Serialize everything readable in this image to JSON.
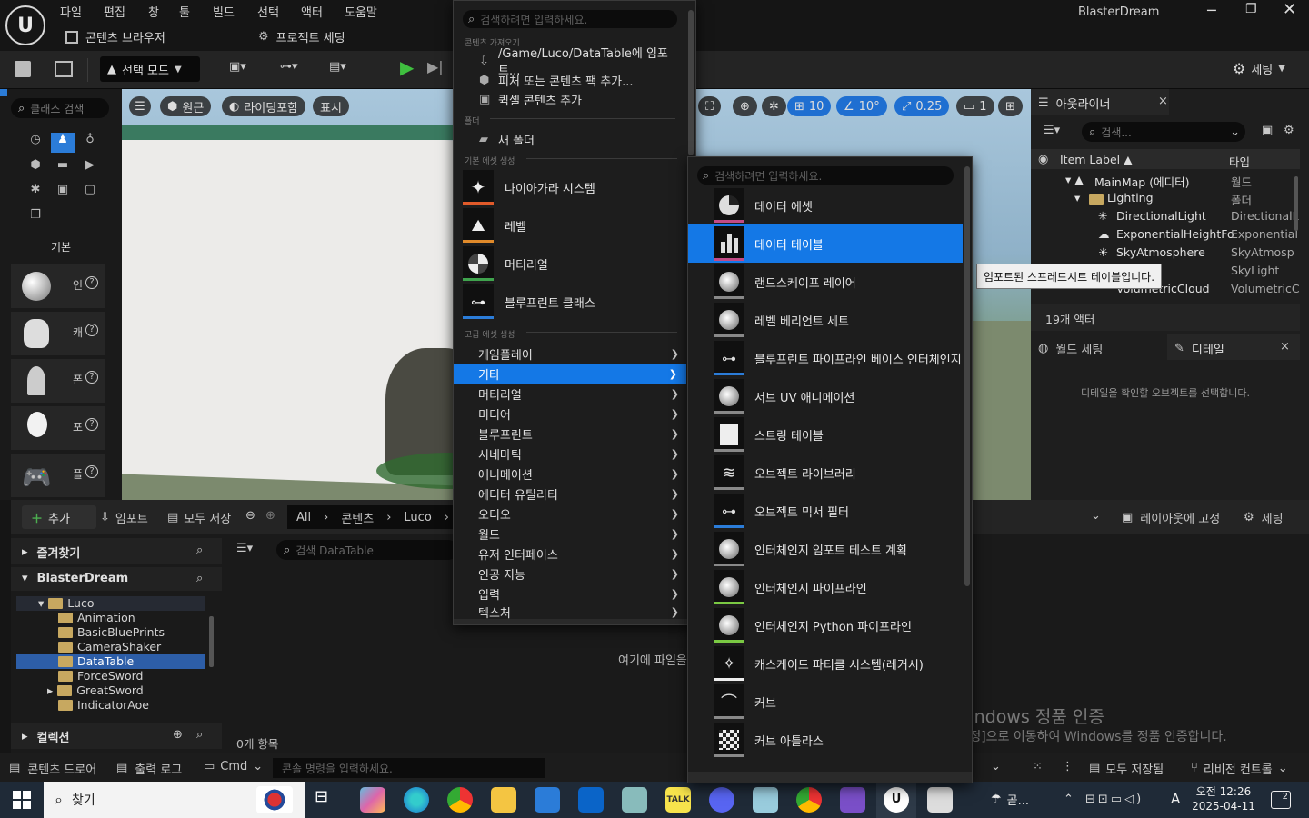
{
  "menubar": {
    "items": [
      "파일",
      "편집",
      "창",
      "툴",
      "빌드",
      "선택",
      "액터",
      "도움말"
    ]
  },
  "window_title": "BlasterDream",
  "tabs": {
    "content_browser": "콘텐츠 브라우저",
    "project_settings": "프로젝트 세팅"
  },
  "toolbar": {
    "select_mode": "선택 모드",
    "settings": "세팅"
  },
  "modes_panel": {
    "search_placeholder": "클래스 검색",
    "category": "기본",
    "items": [
      "인",
      "캐",
      "폰",
      "포",
      "플"
    ]
  },
  "viewport": {
    "perspective": "원근",
    "lit": "라이팅포함",
    "show": "표시",
    "grid_snap": "10",
    "rot_snap": "10°",
    "scale_snap": "0.25",
    "cam_speed": "1"
  },
  "outliner": {
    "title": "아웃라이너",
    "search_placeholder": "검색...",
    "col_label": "Item Label ▲",
    "col_type": "타입",
    "rows": [
      {
        "label": "MainMap (에디터)",
        "type": "월드"
      },
      {
        "label": "Lighting",
        "type": "폴더"
      },
      {
        "label": "DirectionalLight",
        "type": "DirectionalL"
      },
      {
        "label": "ExponentialHeightFo",
        "type": "Exponential"
      },
      {
        "label": "SkyAtmosphere",
        "type": "SkyAtmosp"
      },
      {
        "label": "",
        "type": "SkyLight"
      },
      {
        "label": "VolumetricCloud",
        "type": "VolumetricC"
      }
    ],
    "count": "19개 액터"
  },
  "details": {
    "world_settings": "월드 세팅",
    "title": "디테일",
    "empty": "디테일을 확인할 오브젝트를 선택합니다."
  },
  "tooltip": "임포트된 스프레드시트 테이블입니다.",
  "content_browser": {
    "add": "추가",
    "import": "임포트",
    "save_all": "모두 저장",
    "path": [
      "All",
      "콘텐츠",
      "Luco"
    ],
    "favorites": "즐겨찾기",
    "project": "BlasterDream",
    "folders": [
      "Luco",
      "Animation",
      "BasicBluePrints",
      "CameraShaker",
      "DataTable",
      "ForceSword",
      "GreatSword",
      "IndicatorAoe"
    ],
    "collections": "컬렉션",
    "search_placeholder": "검색 DataTable",
    "item_count": "0개 항목",
    "drop_hint": "여기에 파일을",
    "dock_layout": "레이아웃에 고정",
    "settings": "세팅"
  },
  "statusbar": {
    "content_drawer": "콘텐츠 드로어",
    "output_log": "출력 로그",
    "cmd": "Cmd",
    "console_placeholder": "콘솔 명령을 입력하세요.",
    "save_all": "모두 저장됨",
    "revision": "리비전 컨트롤"
  },
  "menu1": {
    "search_placeholder": "검색하려면 입력하세요.",
    "sec_import": "콘텐츠 가져오기",
    "import_items": [
      "/Game/Luco/DataTable에 임포트...",
      "피처 또는 콘텐츠 팩 추가...",
      "퀵셀 콘텐츠 추가"
    ],
    "sec_folder": "폴더",
    "new_folder": "새 폴더",
    "sec_basic": "기본 에셋 생성",
    "basic_assets": [
      "나이아가라 시스템",
      "레벨",
      "머티리얼",
      "블루프린트 클래스"
    ],
    "sec_advanced": "고급 에셋 생성",
    "advanced": [
      "게임플레이",
      "기타",
      "머티리얼",
      "미디어",
      "블루프린트",
      "시네마틱",
      "애니메이션",
      "에디터 유틸리티",
      "오디오",
      "월드",
      "유저 인터페이스",
      "인공 지능",
      "입력",
      "텍스처"
    ]
  },
  "menu2": {
    "search_placeholder": "검색하려면 입력하세요.",
    "items": [
      "데이터 에셋",
      "데이터 테이블",
      "랜드스케이프 레이어",
      "레벨 베리언트 세트",
      "블루프린트 파이프라인 베이스 인터체인지",
      "서브 UV 애니메이션",
      "스트링 테이블",
      "오브젝트 라이브러리",
      "오브젝트 믹서 필터",
      "인터체인지 임포트 테스트 계획",
      "인터체인지 파이프라인",
      "인터체인지 Python 파이프라인",
      "캐스케이드 파티클 시스템(레거시)",
      "커브",
      "커브 아틀라스"
    ]
  },
  "watermark": {
    "line1": "Windows 정품 인증",
    "line2": "[설정]으로 이동하여 Windows를 정품 인증합니다."
  },
  "taskbar": {
    "search": "찾기",
    "weather": "곧...",
    "time": "오전 12:26",
    "date": "2025-04-11",
    "lang": "A",
    "notif": "2"
  },
  "colors": {
    "accent": "#0f70d8",
    "highlight": "#1478e6"
  }
}
